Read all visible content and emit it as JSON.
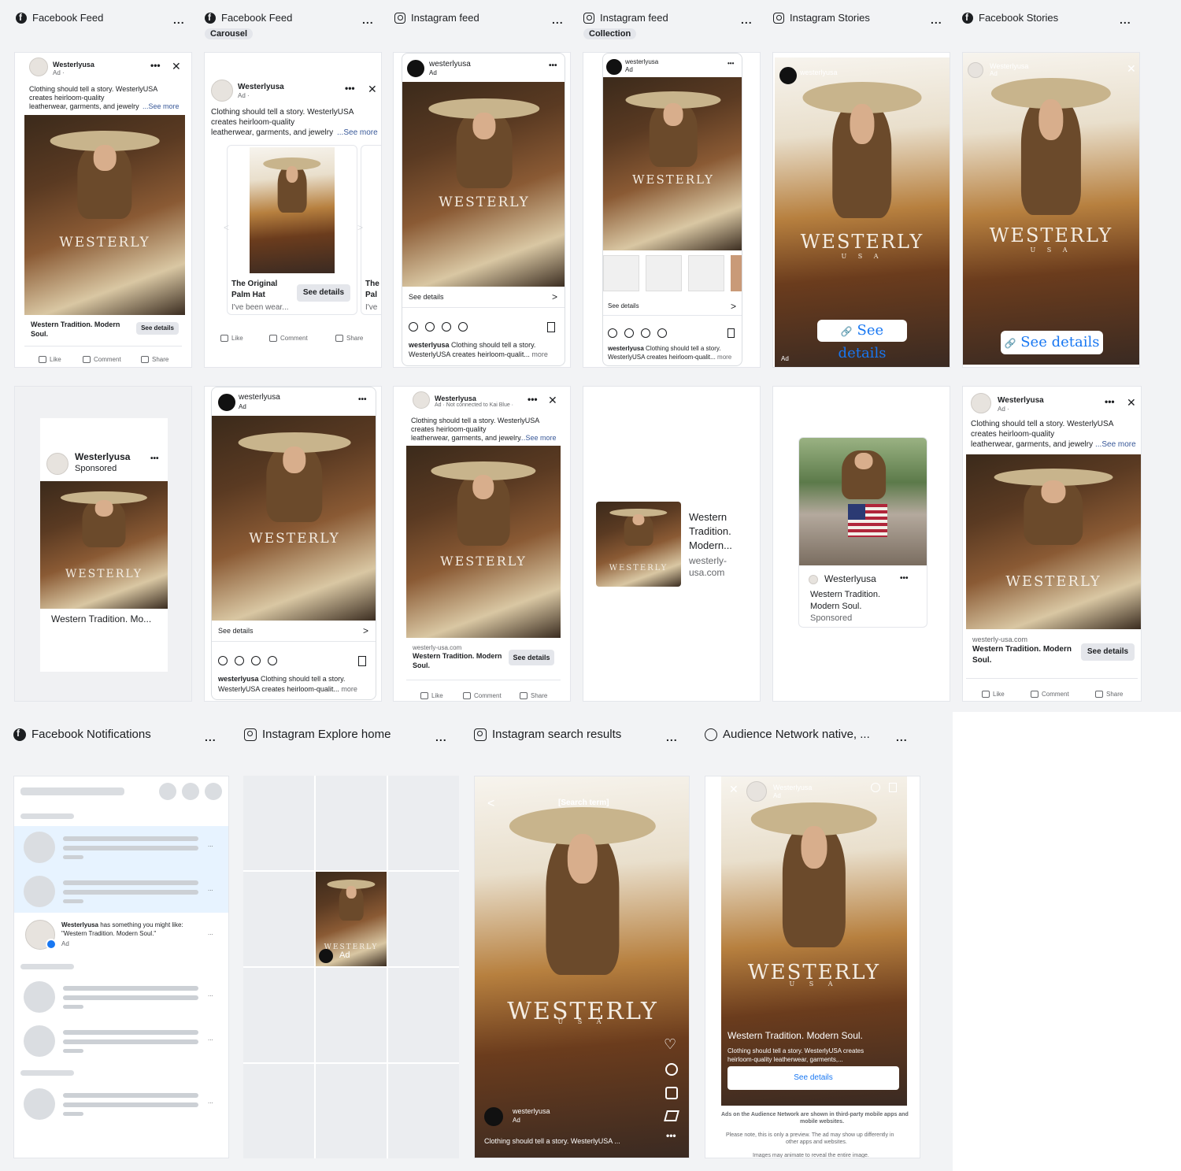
{
  "brand": {
    "name": "Westerlyusa",
    "handle": "westerlyusa",
    "wordmark": "WESTERLY",
    "sub": "U S A",
    "site": "westerly-usa.com"
  },
  "colors": {
    "link": "#385898",
    "ig_blue": "#1877f2"
  },
  "placements": [
    {
      "label": "Facebook Feed",
      "icon": "facebook-icon"
    },
    {
      "label": "Facebook Feed",
      "icon": "facebook-icon",
      "badge": "Carousel"
    },
    {
      "label": "Instagram feed",
      "icon": "instagram-icon"
    },
    {
      "label": "Instagram feed",
      "icon": "instagram-icon",
      "badge": "Collection"
    },
    {
      "label": "Instagram Stories",
      "icon": "instagram-icon"
    },
    {
      "label": "Facebook Stories",
      "icon": "facebook-icon"
    },
    {
      "label": "Facebook Notifications",
      "icon": "facebook-icon"
    },
    {
      "label": "Instagram Explore home",
      "icon": "instagram-icon"
    },
    {
      "label": "Instagram search results",
      "icon": "instagram-icon"
    },
    {
      "label": "Audience Network native, ...",
      "icon": "audience-network-icon"
    }
  ],
  "more": "...",
  "ad": {
    "name": "Westerlyusa",
    "ad_label": "Ad",
    "ad_dot": "Ad · ",
    "sponsored": "Sponsored",
    "not_connected": "Ad · Not connected to Kai Blue ·",
    "body1": "Clothing should tell a story. WesterlyUSA",
    "body2": "creates heirloom-quality",
    "body3": "leatherwear, garments, and jewelry",
    "see_more": "...See more",
    "headline": "Western Tradition. Modern",
    "headline2": "Soul.",
    "headline_full": "Western Tradition. Modern Soul.",
    "headline_trunc": "Western Tradition. Mo...",
    "see_details": "See details",
    "ig_caption1": "Clothing should tell a story.",
    "ig_caption2": "WesterlyUSA creates heirloom-qualit...",
    "more": "more",
    "like": "Like",
    "comment": "Comment",
    "share": "Share",
    "carousel_title1": "The Original",
    "carousel_title2": "Palm Hat",
    "carousel_desc": "I've been wear...",
    "carousel_peek1": "The",
    "carousel_peek2": "Pal",
    "carousel_peek3": "I've",
    "arrow": ">",
    "back": "<",
    "close": "✕",
    "dots": "•••",
    "link_glyph": "🔗",
    "heart": "♡",
    "search_term": "[Search term]",
    "search_caption": "Clothing should tell a story. WesterlyUSA ...",
    "audience_caption1": "Clothing should tell a story. WesterlyUSA creates",
    "audience_caption2": "heirloom-quality leatherwear, garments,...",
    "audience_note1": "Ads on the Audience Network are shown in third-party mobile apps and",
    "audience_note2": "mobile websites.",
    "audience_note3": "Please note, this is only a preview. The ad may show up differently in",
    "audience_note4": "other apps and websites.",
    "audience_note5": "Images may animate to reveal the entire image.",
    "native_headline1": "Western",
    "native_headline2": "Tradition.",
    "native_headline3": "Modern...",
    "native_site1": "westerly-",
    "native_site2": "usa.com",
    "card_headline1": "Western Tradition.",
    "card_headline2": "Modern Soul.",
    "notif_text1": "has something you might like:",
    "notif_text2": "\"Western Tradition. Modern Soul.\""
  }
}
